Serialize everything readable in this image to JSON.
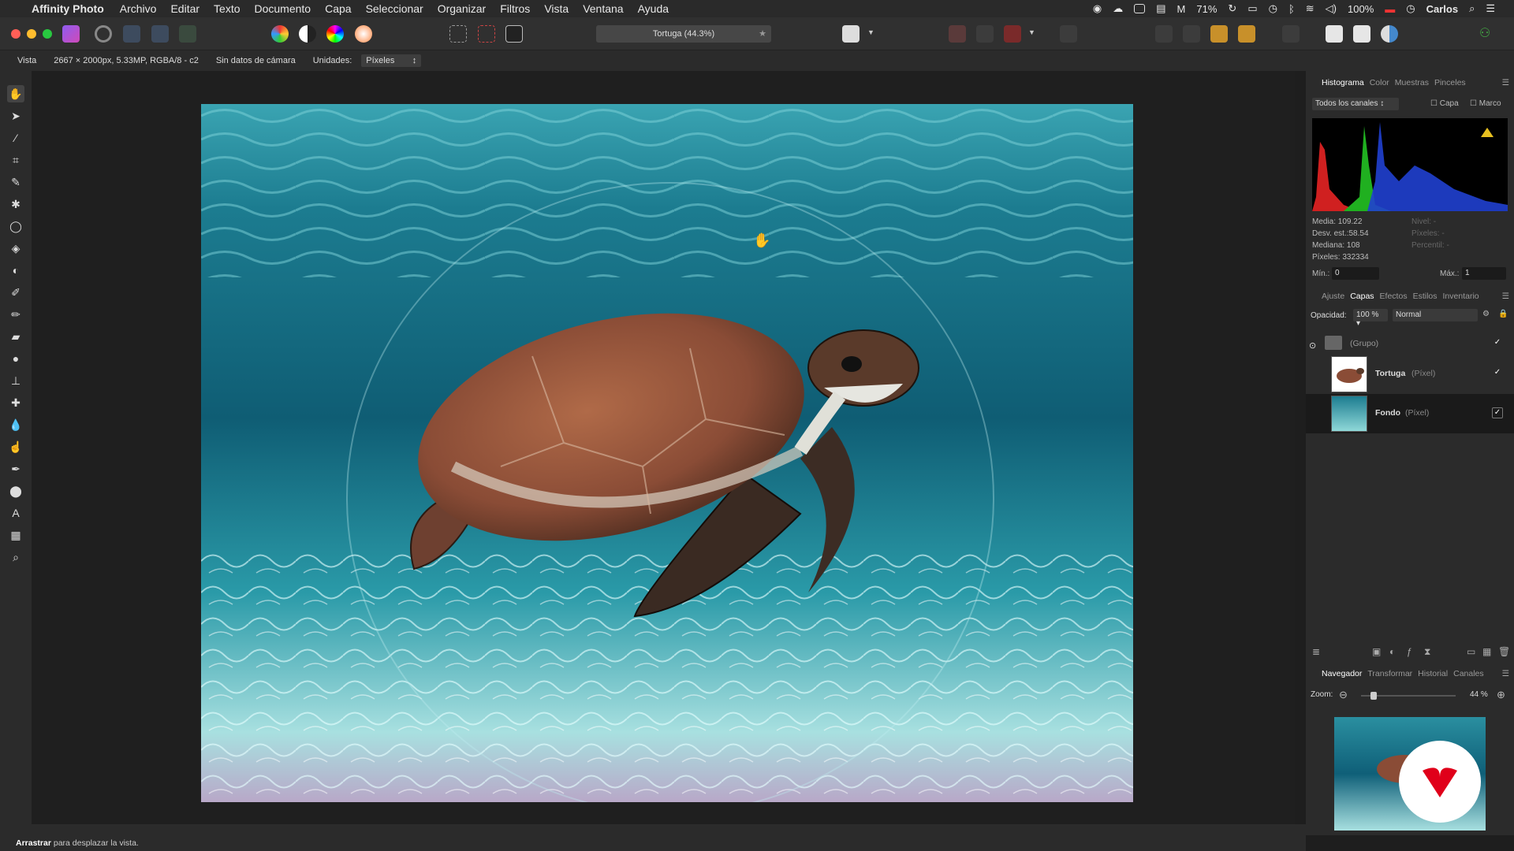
{
  "menubar": {
    "app_name": "Affinity Photo",
    "items": [
      "Archivo",
      "Editar",
      "Texto",
      "Documento",
      "Capa",
      "Seleccionar",
      "Organizar",
      "Filtros",
      "Vista",
      "Ventana",
      "Ayuda"
    ],
    "battery_small": "71%",
    "battery": "100%",
    "user": "Carlos"
  },
  "toolbar": {
    "document_title": "Tortuga (44.3%)"
  },
  "contextbar": {
    "vista": "Vista",
    "doc_info": "2667 × 2000px, 5.33MP, RGBA/8 - c2",
    "camera": "Sin datos de cámara",
    "units_label": "Unidades:",
    "units_value": "Píxeles"
  },
  "histogram": {
    "tabs": [
      "Histograma",
      "Color",
      "Muestras",
      "Pinceles"
    ],
    "channel": "Todos los canales",
    "capa": "Capa",
    "marco": "Marco",
    "media": "Media: 109.22",
    "desv": "Desv. est.:58.54",
    "mediana": "Mediana: 108",
    "pixeles": "Píxeles: 332334",
    "nivel": "Nivel: -",
    "pixeles_dim": "Píxeles: -",
    "percentil": "Percentil: -",
    "min_label": "Mín.:",
    "min_value": "0",
    "max_label": "Máx.:",
    "max_value": "1"
  },
  "layers": {
    "tabs": [
      "Ajuste",
      "Capas",
      "Efectos",
      "Estilos",
      "Inventario"
    ],
    "opacity_label": "Opacidad:",
    "opacity_value": "100 %",
    "blend_mode": "Normal",
    "group": "(Grupo)",
    "layer1_name": "Tortuga",
    "layer1_type": "(Píxel)",
    "layer2_name": "Fondo",
    "layer2_type": "(Píxel)",
    "check": "✓"
  },
  "navigator": {
    "tabs": [
      "Navegador",
      "Transformar",
      "Historial",
      "Canales"
    ],
    "zoom_label": "Zoom:",
    "zoom_value": "44 %"
  },
  "status": {
    "bold": "Arrastrar",
    "text": " para desplazar la vista."
  },
  "colors": {
    "accent": "#4a7cdc",
    "water_top": "#2a8fa0",
    "water_mid": "#0f5f78",
    "sand": "#8fd8d8",
    "traffic_red": "#ff5f57",
    "traffic_yellow": "#febc2e",
    "traffic_green": "#28c840"
  }
}
